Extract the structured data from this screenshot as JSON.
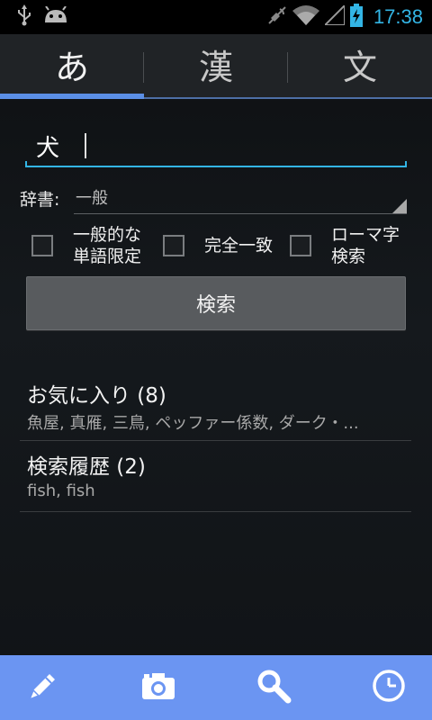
{
  "status_bar": {
    "clock": "17:38",
    "icons": [
      "usb-icon",
      "android-icon",
      "mute-icon",
      "wifi-icon",
      "signal-icon",
      "battery-charging-icon"
    ],
    "clock_color": "#33b5e5"
  },
  "tabs": [
    {
      "label": "あ",
      "active": true
    },
    {
      "label": "漢",
      "active": false
    },
    {
      "label": "文",
      "active": false
    }
  ],
  "search": {
    "value": "犬",
    "placeholder": ""
  },
  "dictionary": {
    "label": "辞書:",
    "selected": "一般"
  },
  "options": [
    {
      "label_line1": "一般的な",
      "label_line2": "単語限定",
      "checked": false
    },
    {
      "label_line1": "完全一致",
      "label_line2": "",
      "checked": false
    },
    {
      "label_line1": "ローマ字",
      "label_line2": "検索",
      "checked": false
    }
  ],
  "search_button": {
    "label": "検索"
  },
  "favorites": {
    "title": "お気に入り (8)",
    "preview": "魚屋, 真雁, 三鳥, ペッファー係数, ダーク・..."
  },
  "history": {
    "title": "検索履歴 (2)",
    "preview": "fish, fish"
  },
  "bottom_bar": {
    "color": "#6b95f2",
    "icons": [
      "pencil-icon",
      "camera-icon",
      "search-icon",
      "clock-icon"
    ]
  },
  "accent_color": "#33b5e5"
}
